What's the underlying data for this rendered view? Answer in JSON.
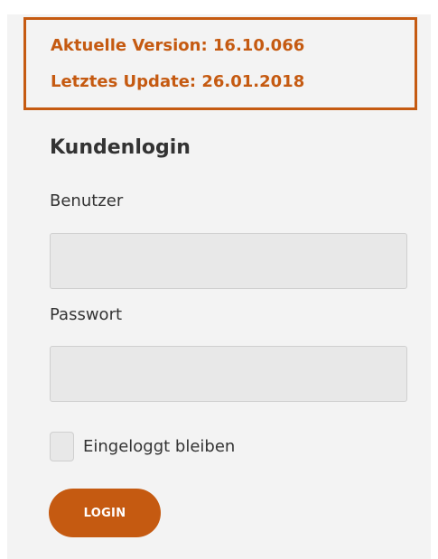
{
  "version_info": {
    "current_version": "Aktuelle Version: 16.10.066",
    "last_update": "Letztes Update: 26.01.2018",
    "accent_color": "#c55a11"
  },
  "login": {
    "title": "Kundenlogin",
    "user_label": "Benutzer",
    "user_value": "",
    "password_label": "Passwort",
    "password_value": "",
    "remember_label": "Eingeloggt bleiben",
    "remember_checked": false,
    "button_label": "LOGIN"
  }
}
